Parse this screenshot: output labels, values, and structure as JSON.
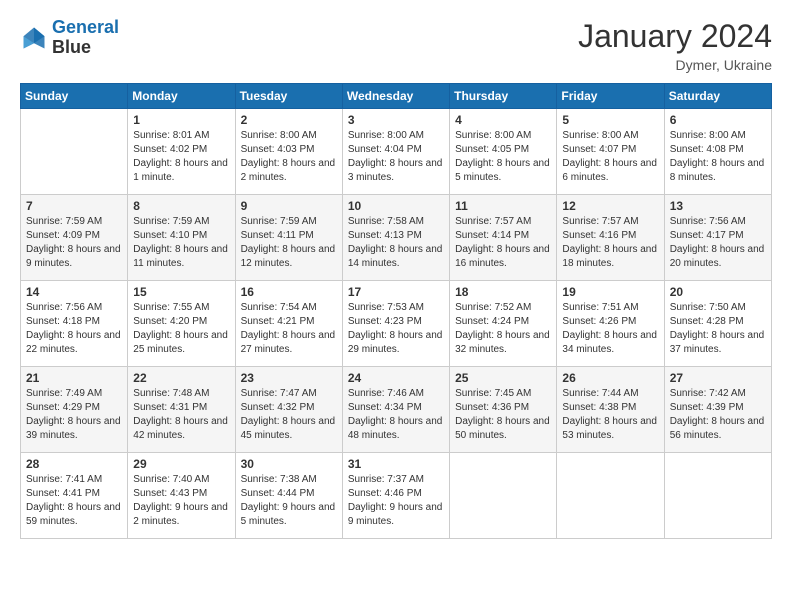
{
  "header": {
    "logo_line1": "General",
    "logo_line2": "Blue",
    "month": "January 2024",
    "location": "Dymer, Ukraine"
  },
  "days": [
    "Sunday",
    "Monday",
    "Tuesday",
    "Wednesday",
    "Thursday",
    "Friday",
    "Saturday"
  ],
  "weeks": [
    [
      {
        "date": "",
        "sunrise": "",
        "sunset": "",
        "daylight": ""
      },
      {
        "date": "1",
        "sunrise": "Sunrise: 8:01 AM",
        "sunset": "Sunset: 4:02 PM",
        "daylight": "Daylight: 8 hours and 1 minute."
      },
      {
        "date": "2",
        "sunrise": "Sunrise: 8:00 AM",
        "sunset": "Sunset: 4:03 PM",
        "daylight": "Daylight: 8 hours and 2 minutes."
      },
      {
        "date": "3",
        "sunrise": "Sunrise: 8:00 AM",
        "sunset": "Sunset: 4:04 PM",
        "daylight": "Daylight: 8 hours and 3 minutes."
      },
      {
        "date": "4",
        "sunrise": "Sunrise: 8:00 AM",
        "sunset": "Sunset: 4:05 PM",
        "daylight": "Daylight: 8 hours and 5 minutes."
      },
      {
        "date": "5",
        "sunrise": "Sunrise: 8:00 AM",
        "sunset": "Sunset: 4:07 PM",
        "daylight": "Daylight: 8 hours and 6 minutes."
      },
      {
        "date": "6",
        "sunrise": "Sunrise: 8:00 AM",
        "sunset": "Sunset: 4:08 PM",
        "daylight": "Daylight: 8 hours and 8 minutes."
      }
    ],
    [
      {
        "date": "7",
        "sunrise": "Sunrise: 7:59 AM",
        "sunset": "Sunset: 4:09 PM",
        "daylight": "Daylight: 8 hours and 9 minutes."
      },
      {
        "date": "8",
        "sunrise": "Sunrise: 7:59 AM",
        "sunset": "Sunset: 4:10 PM",
        "daylight": "Daylight: 8 hours and 11 minutes."
      },
      {
        "date": "9",
        "sunrise": "Sunrise: 7:59 AM",
        "sunset": "Sunset: 4:11 PM",
        "daylight": "Daylight: 8 hours and 12 minutes."
      },
      {
        "date": "10",
        "sunrise": "Sunrise: 7:58 AM",
        "sunset": "Sunset: 4:13 PM",
        "daylight": "Daylight: 8 hours and 14 minutes."
      },
      {
        "date": "11",
        "sunrise": "Sunrise: 7:57 AM",
        "sunset": "Sunset: 4:14 PM",
        "daylight": "Daylight: 8 hours and 16 minutes."
      },
      {
        "date": "12",
        "sunrise": "Sunrise: 7:57 AM",
        "sunset": "Sunset: 4:16 PM",
        "daylight": "Daylight: 8 hours and 18 minutes."
      },
      {
        "date": "13",
        "sunrise": "Sunrise: 7:56 AM",
        "sunset": "Sunset: 4:17 PM",
        "daylight": "Daylight: 8 hours and 20 minutes."
      }
    ],
    [
      {
        "date": "14",
        "sunrise": "Sunrise: 7:56 AM",
        "sunset": "Sunset: 4:18 PM",
        "daylight": "Daylight: 8 hours and 22 minutes."
      },
      {
        "date": "15",
        "sunrise": "Sunrise: 7:55 AM",
        "sunset": "Sunset: 4:20 PM",
        "daylight": "Daylight: 8 hours and 25 minutes."
      },
      {
        "date": "16",
        "sunrise": "Sunrise: 7:54 AM",
        "sunset": "Sunset: 4:21 PM",
        "daylight": "Daylight: 8 hours and 27 minutes."
      },
      {
        "date": "17",
        "sunrise": "Sunrise: 7:53 AM",
        "sunset": "Sunset: 4:23 PM",
        "daylight": "Daylight: 8 hours and 29 minutes."
      },
      {
        "date": "18",
        "sunrise": "Sunrise: 7:52 AM",
        "sunset": "Sunset: 4:24 PM",
        "daylight": "Daylight: 8 hours and 32 minutes."
      },
      {
        "date": "19",
        "sunrise": "Sunrise: 7:51 AM",
        "sunset": "Sunset: 4:26 PM",
        "daylight": "Daylight: 8 hours and 34 minutes."
      },
      {
        "date": "20",
        "sunrise": "Sunrise: 7:50 AM",
        "sunset": "Sunset: 4:28 PM",
        "daylight": "Daylight: 8 hours and 37 minutes."
      }
    ],
    [
      {
        "date": "21",
        "sunrise": "Sunrise: 7:49 AM",
        "sunset": "Sunset: 4:29 PM",
        "daylight": "Daylight: 8 hours and 39 minutes."
      },
      {
        "date": "22",
        "sunrise": "Sunrise: 7:48 AM",
        "sunset": "Sunset: 4:31 PM",
        "daylight": "Daylight: 8 hours and 42 minutes."
      },
      {
        "date": "23",
        "sunrise": "Sunrise: 7:47 AM",
        "sunset": "Sunset: 4:32 PM",
        "daylight": "Daylight: 8 hours and 45 minutes."
      },
      {
        "date": "24",
        "sunrise": "Sunrise: 7:46 AM",
        "sunset": "Sunset: 4:34 PM",
        "daylight": "Daylight: 8 hours and 48 minutes."
      },
      {
        "date": "25",
        "sunrise": "Sunrise: 7:45 AM",
        "sunset": "Sunset: 4:36 PM",
        "daylight": "Daylight: 8 hours and 50 minutes."
      },
      {
        "date": "26",
        "sunrise": "Sunrise: 7:44 AM",
        "sunset": "Sunset: 4:38 PM",
        "daylight": "Daylight: 8 hours and 53 minutes."
      },
      {
        "date": "27",
        "sunrise": "Sunrise: 7:42 AM",
        "sunset": "Sunset: 4:39 PM",
        "daylight": "Daylight: 8 hours and 56 minutes."
      }
    ],
    [
      {
        "date": "28",
        "sunrise": "Sunrise: 7:41 AM",
        "sunset": "Sunset: 4:41 PM",
        "daylight": "Daylight: 8 hours and 59 minutes."
      },
      {
        "date": "29",
        "sunrise": "Sunrise: 7:40 AM",
        "sunset": "Sunset: 4:43 PM",
        "daylight": "Daylight: 9 hours and 2 minutes."
      },
      {
        "date": "30",
        "sunrise": "Sunrise: 7:38 AM",
        "sunset": "Sunset: 4:44 PM",
        "daylight": "Daylight: 9 hours and 5 minutes."
      },
      {
        "date": "31",
        "sunrise": "Sunrise: 7:37 AM",
        "sunset": "Sunset: 4:46 PM",
        "daylight": "Daylight: 9 hours and 9 minutes."
      },
      {
        "date": "",
        "sunrise": "",
        "sunset": "",
        "daylight": ""
      },
      {
        "date": "",
        "sunrise": "",
        "sunset": "",
        "daylight": ""
      },
      {
        "date": "",
        "sunrise": "",
        "sunset": "",
        "daylight": ""
      }
    ]
  ]
}
